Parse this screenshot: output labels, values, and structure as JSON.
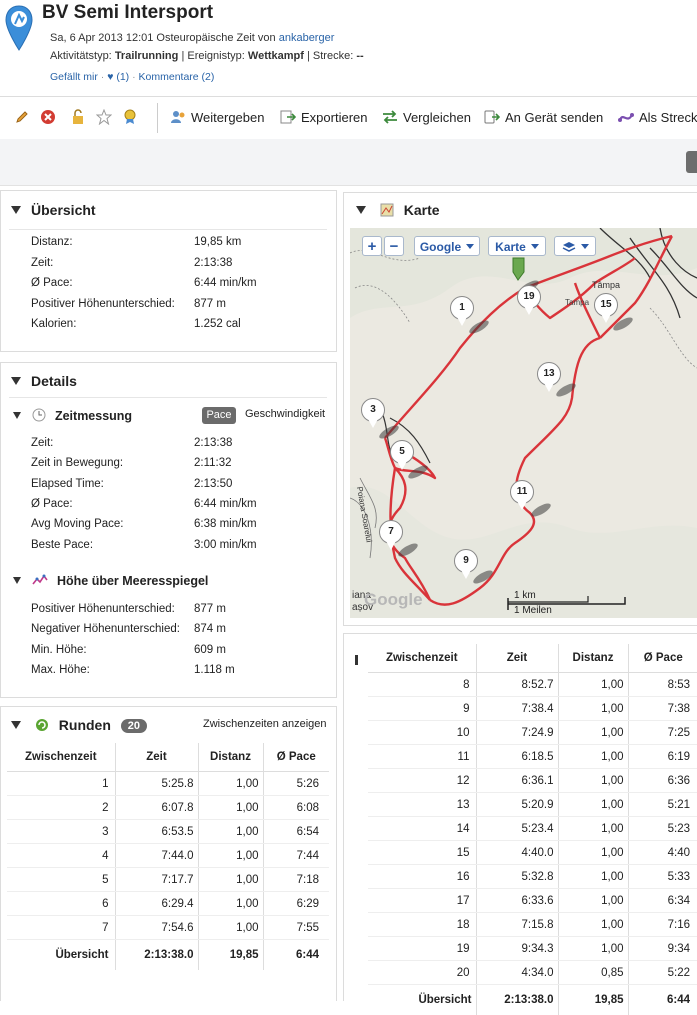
{
  "header": {
    "title": "BV Semi Intersport",
    "date_text": "Sa, 6 Apr 2013 12:01 Osteuropäische Zeit von",
    "author": "ankaberger",
    "activity_label": "Aktivitätstyp:",
    "activity_value": "Trailrunning",
    "event_label": "| Ereignistyp:",
    "event_value": "Wettkampf",
    "route_label": "| Strecke:",
    "route_value": "--",
    "like_label": "Gefällt mir",
    "like_count": "♥ (1)",
    "comments_label": "Kommentare (2)",
    "dot": "·"
  },
  "toolbar": {
    "share": "Weitergeben",
    "export": "Exportieren",
    "compare": "Vergleichen",
    "send": "An Gerät senden",
    "as_route": "Als Strecke"
  },
  "overview": {
    "title": "Übersicht",
    "rows": [
      {
        "label": "Distanz:",
        "value": "19,85 km"
      },
      {
        "label": "Zeit:",
        "value": "2:13:38"
      },
      {
        "label": "Ø Pace:",
        "value": "6:44 min/km"
      },
      {
        "label": "Positiver Höhenunterschied:",
        "value": "877 m"
      },
      {
        "label": "Kalorien:",
        "value": "1.252 cal"
      }
    ]
  },
  "details": {
    "title": "Details",
    "timing_title": "Zeitmessung",
    "toggle_pace": "Pace",
    "toggle_speed": "Geschwindigkeit",
    "timing_rows": [
      {
        "label": "Zeit:",
        "value": "2:13:38"
      },
      {
        "label": "Zeit in Bewegung:",
        "value": "2:11:32"
      },
      {
        "label": "Elapsed Time:",
        "value": "2:13:50"
      },
      {
        "label": "Ø Pace:",
        "value": "6:44 min/km"
      },
      {
        "label": "Avg Moving Pace:",
        "value": "6:38 min/km"
      },
      {
        "label": "Beste Pace:",
        "value": "3:00 min/km"
      }
    ],
    "elev_title": "Höhe über Meeresspiegel",
    "elev_rows": [
      {
        "label": "Positiver Höhenunterschied:",
        "value": "877 m"
      },
      {
        "label": "Negativer Höhenunterschied:",
        "value": "874 m"
      },
      {
        "label": "Min. Höhe:",
        "value": "609 m"
      },
      {
        "label": "Max. Höhe:",
        "value": "1.118 m"
      }
    ]
  },
  "laps": {
    "title": "Runden",
    "count": "20",
    "show_splits": "Zwischenzeiten anzeigen",
    "headers": [
      "Zwischenzeit",
      "Zeit",
      "Distanz",
      "Ø Pace"
    ],
    "rows": [
      [
        "1",
        "5:25.8",
        "1,00",
        "5:26"
      ],
      [
        "2",
        "6:07.8",
        "1,00",
        "6:08"
      ],
      [
        "3",
        "6:53.5",
        "1,00",
        "6:54"
      ],
      [
        "4",
        "7:44.0",
        "1,00",
        "7:44"
      ],
      [
        "5",
        "7:17.7",
        "1,00",
        "7:18"
      ],
      [
        "6",
        "6:29.4",
        "1,00",
        "6:29"
      ],
      [
        "7",
        "7:54.6",
        "1,00",
        "7:55"
      ]
    ],
    "rows_right": [
      [
        "8",
        "8:52.7",
        "1,00",
        "8:53"
      ],
      [
        "9",
        "7:38.4",
        "1,00",
        "7:38"
      ],
      [
        "10",
        "7:24.9",
        "1,00",
        "7:25"
      ],
      [
        "11",
        "6:18.5",
        "1,00",
        "6:19"
      ],
      [
        "12",
        "6:36.1",
        "1,00",
        "6:36"
      ],
      [
        "13",
        "5:20.9",
        "1,00",
        "5:21"
      ],
      [
        "14",
        "5:23.4",
        "1,00",
        "5:23"
      ],
      [
        "15",
        "4:40.0",
        "1,00",
        "4:40"
      ],
      [
        "16",
        "5:32.8",
        "1,00",
        "5:33"
      ],
      [
        "17",
        "6:33.6",
        "1,00",
        "6:34"
      ],
      [
        "18",
        "7:15.8",
        "1,00",
        "7:16"
      ],
      [
        "19",
        "9:34.3",
        "1,00",
        "9:34"
      ],
      [
        "20",
        "4:34.0",
        "0,85",
        "5:22"
      ]
    ],
    "total": [
      "Übersicht",
      "2:13:38.0",
      "19,85",
      "6:44"
    ]
  },
  "map": {
    "title": "Karte",
    "zoom_in": "+",
    "zoom_out": "−",
    "provider": "Google",
    "map_type": "Karte",
    "town1": "Tampa",
    "town2": "Tâmpa",
    "road_label": "Poiana Soarelui",
    "edge_label1": "iana",
    "edge_label2": "așov",
    "watermark": "Google",
    "scale_km": "1 km",
    "scale_mi": "1 Meilen",
    "markers": [
      "1",
      "3",
      "5",
      "7",
      "9",
      "11",
      "13",
      "15",
      "19"
    ],
    "route_color": "#d9343a"
  },
  "colors": {
    "link": "#2a64a8",
    "badge": "#6b6b6b"
  }
}
